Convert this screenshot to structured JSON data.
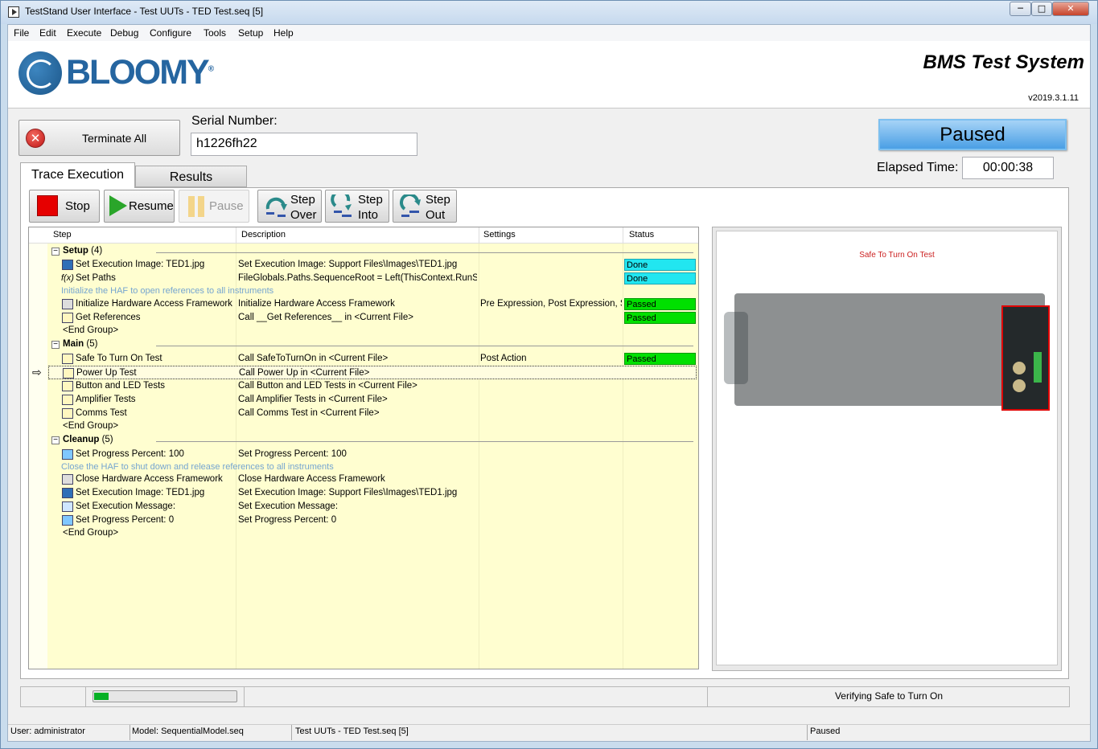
{
  "window": {
    "title": "TestStand User Interface - Test UUTs - TED Test.seq [5]",
    "minimize": "─",
    "maximize": "□",
    "close": "✕"
  },
  "menu": [
    "File",
    "Edit",
    "Execute",
    "Debug",
    "Configure",
    "Tools",
    "Setup",
    "Help"
  ],
  "header": {
    "logo_text": "BLOOMY",
    "logo_mark": "®",
    "app_title": "BMS Test System",
    "version": "v2019.3.1.11"
  },
  "controls": {
    "terminate_label": "Terminate All",
    "serial_label": "Serial Number:",
    "serial_value": "h1226fh22",
    "status": "Paused",
    "elapsed_label": "Elapsed Time:",
    "elapsed_value": "00:00:38"
  },
  "tabs": [
    "Trace Execution",
    "Results"
  ],
  "toolbar": {
    "stop": "Stop",
    "resume": "Resume",
    "pause": "Pause",
    "step_over": [
      "Step",
      "Over"
    ],
    "step_into": [
      "Step",
      "Into"
    ],
    "step_out": [
      "Step",
      "Out"
    ]
  },
  "columns": [
    "Step",
    "Description",
    "Settings",
    "Status"
  ],
  "groups": {
    "setup": {
      "name": "Setup",
      "count": "(4)"
    },
    "main": {
      "name": "Main",
      "count": "(5)"
    },
    "cleanup": {
      "name": "Cleanup",
      "count": "(5)"
    },
    "end": "<End Group>"
  },
  "comments": {
    "setup": "Initialize the HAF to open references to all instruments",
    "cleanup": "Close the HAF to shut down and release references to all instruments"
  },
  "steps": {
    "s1": {
      "name": "Set Execution Image: TED1.jpg",
      "desc": "Set Execution Image: Support Files\\Images\\TED1.jpg",
      "settings": "",
      "status": "Done"
    },
    "s2": {
      "name": "Set Paths",
      "desc": "FileGlobals.Paths.SequenceRoot = Left(ThisContext.RunStat...",
      "settings": "",
      "status": "Done"
    },
    "s3": {
      "name": "Initialize Hardware Access Framework",
      "desc": "Initialize Hardware Access Framework",
      "settings": "Pre Expression, Post Expression, St...",
      "status": "Passed"
    },
    "s4": {
      "name": "Get References",
      "desc": "Call __Get References__ in <Current File>",
      "settings": "",
      "status": "Passed"
    },
    "m1": {
      "name": "Safe To Turn On Test",
      "desc": "Call SafeToTurnOn in <Current File>",
      "settings": "Post Action",
      "status": "Passed"
    },
    "m2": {
      "name": "Power Up Test",
      "desc": "Call Power Up in <Current File>",
      "settings": "",
      "status": ""
    },
    "m3": {
      "name": "Button and LED Tests",
      "desc": "Call Button and LED Tests in <Current File>",
      "settings": "",
      "status": ""
    },
    "m4": {
      "name": "Amplifier Tests",
      "desc": "Call Amplifier Tests in <Current File>",
      "settings": "",
      "status": ""
    },
    "m5": {
      "name": "Comms Test",
      "desc": "Call Comms Test in <Current File>",
      "settings": "",
      "status": ""
    },
    "c1": {
      "name": "Set Progress Percent: 100",
      "desc": "Set Progress Percent: 100",
      "settings": "",
      "status": ""
    },
    "c2": {
      "name": "Close Hardware Access Framework",
      "desc": "Close Hardware Access Framework",
      "settings": "",
      "status": ""
    },
    "c3": {
      "name": "Set Execution Image: TED1.jpg",
      "desc": "Set Execution Image: Support Files\\Images\\TED1.jpg",
      "settings": "",
      "status": ""
    },
    "c4": {
      "name": "Set Execution Message:",
      "desc": "Set Execution Message:",
      "settings": "",
      "status": ""
    },
    "c5": {
      "name": "Set Progress Percent: 0",
      "desc": "Set Progress Percent: 0",
      "settings": "",
      "status": ""
    }
  },
  "colors": {
    "done": "#22e6f0",
    "passed": "#00e000",
    "status_box": "#4a9fe5"
  },
  "image": {
    "caption": "Safe To Turn On Test"
  },
  "progress": {
    "percent": 10,
    "message": "Verifying Safe to Turn On"
  },
  "statusbar": {
    "user": "User: administrator",
    "model": "Model: SequentialModel.seq",
    "file": "Test UUTs - TED Test.seq [5]",
    "state": "Paused"
  }
}
